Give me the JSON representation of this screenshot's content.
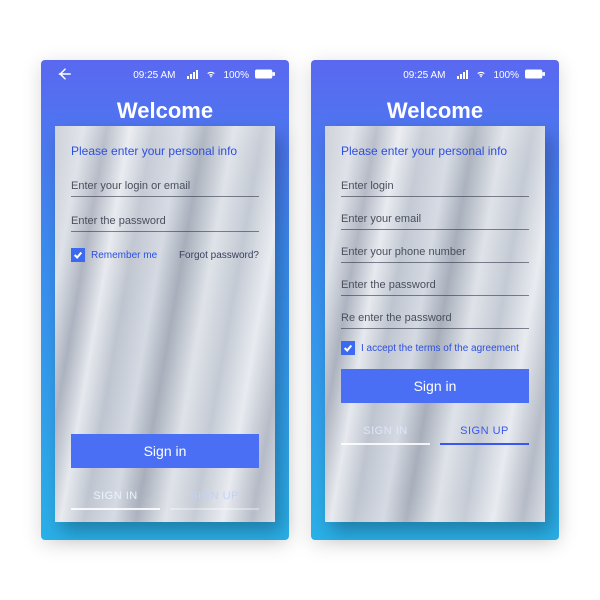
{
  "status": {
    "time": "09:25 AM",
    "battery": "100%"
  },
  "title": "Welcome",
  "subtitle": "Please enter your personal info",
  "signin": {
    "login_ph": "Enter your login or email",
    "password_ph": "Enter the password",
    "remember": "Remember me",
    "forgot": "Forgot password?",
    "button": "Sign in"
  },
  "signup": {
    "login_ph": "Enter login",
    "email_ph": "Enter your email",
    "phone_ph": "Enter your phone number",
    "password_ph": "Enter the password",
    "repassword_ph": "Re enter the password",
    "terms": "I accept the terms of the agreement",
    "button": "Sign in"
  },
  "tabs": {
    "signin": "SIGN IN",
    "signup": "SIGN UP"
  }
}
